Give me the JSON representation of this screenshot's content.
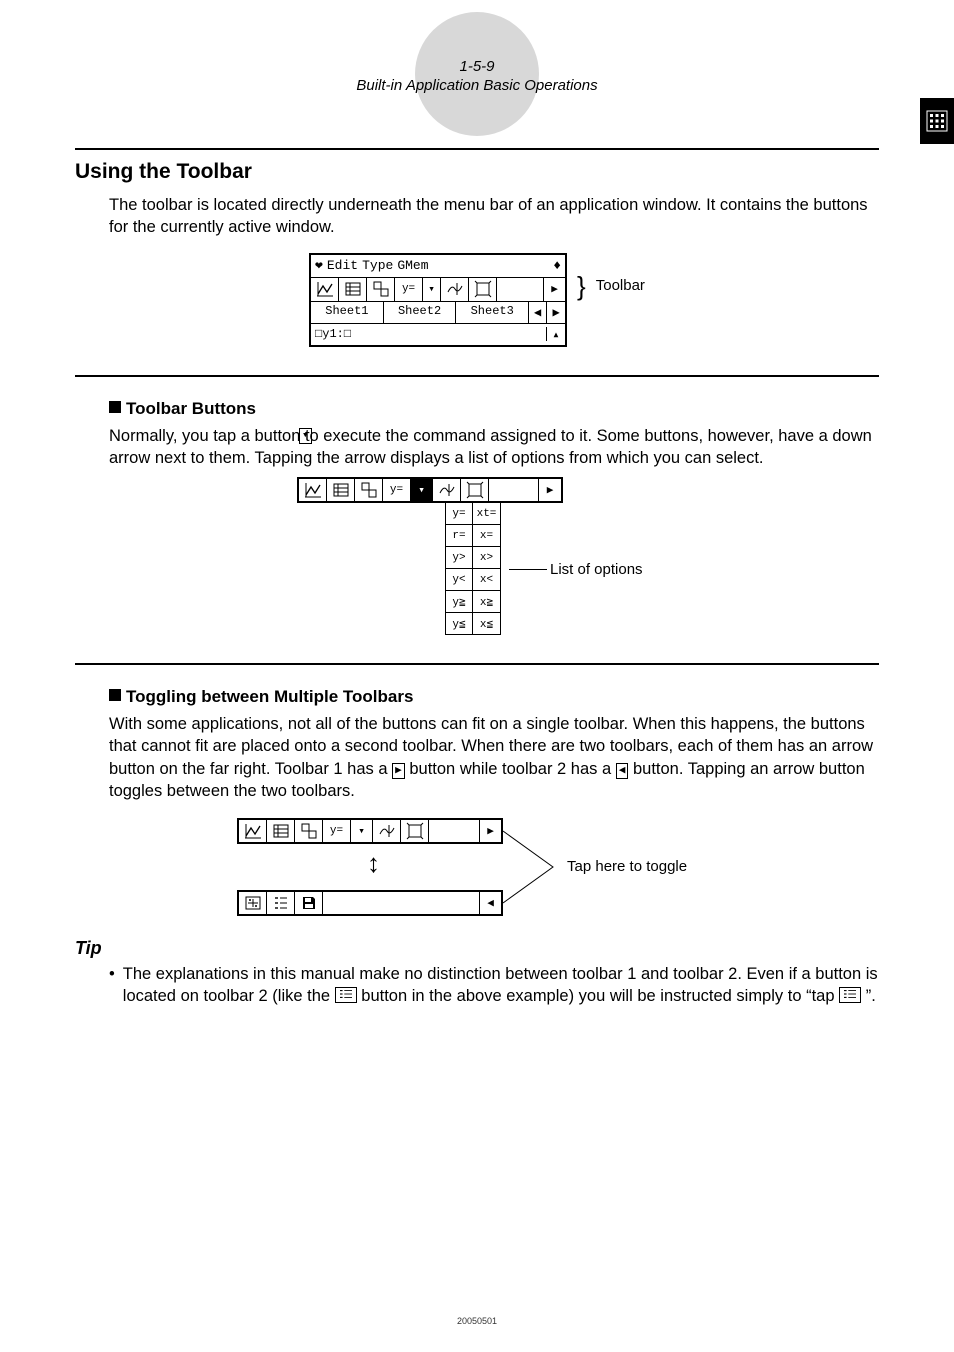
{
  "page_number": "1-5-9",
  "page_subtitle": "Built-in Application Basic Operations",
  "section_title": "Using the Toolbar",
  "intro_paragraph": "The toolbar is located directly underneath the menu bar of an application window. It contains the buttons for the currently active window.",
  "figure1": {
    "menubar": [
      "Edit",
      "Type",
      "GMem"
    ],
    "tabs": [
      "Sheet1",
      "Sheet2",
      "Sheet3"
    ],
    "input_prefix": "□y1:□",
    "toolbar_label": "Toolbar"
  },
  "sub1": {
    "heading": "Toolbar Buttons",
    "paragraph": "Normally, you tap a button to execute the command assigned to it. Some buttons, however, have a down arrow       next to them. Tapping the arrow displays a list of options from which you can select.",
    "callout": "List of options",
    "dropdown": [
      [
        "y=",
        "xt="
      ],
      [
        "r=",
        "x="
      ],
      [
        "y>",
        "x>"
      ],
      [
        "y<",
        "x<"
      ],
      [
        "y≧",
        "x≧"
      ],
      [
        "y≦",
        "x≦"
      ]
    ]
  },
  "sub2": {
    "heading": "Toggling between Multiple Toolbars",
    "paragraph_part1": "With some applications, not all of the buttons can fit on a single toolbar. When this happens, the buttons that cannot fit are placed onto a second toolbar. When there are two toolbars, each of them has an arrow button on the far right. Toolbar 1 has a ",
    "paragraph_part2": " button while toolbar 2 has a ",
    "paragraph_part3": " button. Tapping an arrow button toggles between the two toolbars.",
    "callout": "Tap here to toggle"
  },
  "tip": {
    "heading": "Tip",
    "text_part1": "The explanations in this manual make no distinction between toolbar 1 and toolbar 2. Even if a button is located on toolbar 2 (like the ",
    "text_part2": " button in the above example) you will be instructed simply to “tap ",
    "text_part3": "”."
  },
  "footer": "20050501",
  "icons": {
    "right_triangle": "▶",
    "left_triangle": "◀",
    "down_small": "▾",
    "up_small": "▴",
    "updown": "↕",
    "diamond": "♦",
    "checkmark_bold": "❤"
  }
}
